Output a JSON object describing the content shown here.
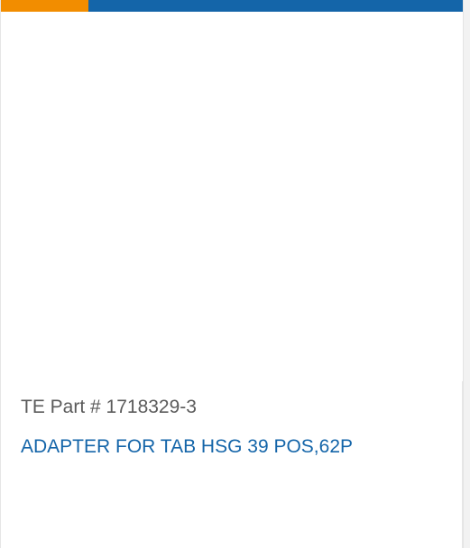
{
  "colors": {
    "accent_orange": "#f28d00",
    "accent_blue": "#1465a9",
    "text_gray": "#5b5b5b"
  },
  "product": {
    "part_number": "TE Part # 1718329-3",
    "description": "ADAPTER FOR TAB HSG 39 POS,62P"
  }
}
